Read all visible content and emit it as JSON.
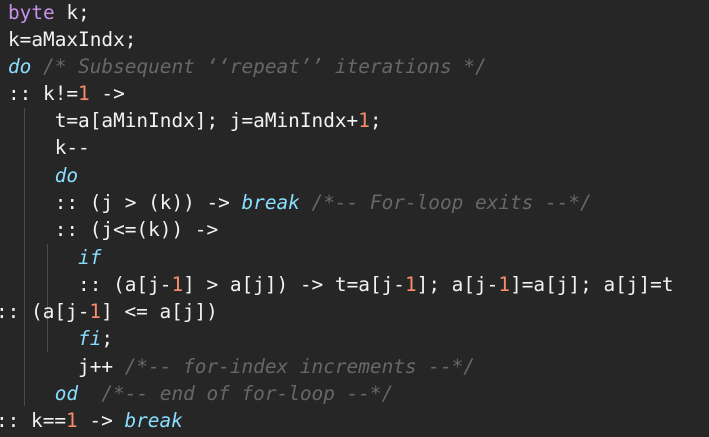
{
  "lines": [
    [
      {
        "t": "byte",
        "c": "kw-type"
      },
      {
        "t": " k;",
        "c": ""
      }
    ],
    [
      {
        "t": "k=aMaxIndx;",
        "c": ""
      }
    ],
    [
      {
        "t": "do",
        "c": "kw-ctrl"
      },
      {
        "t": " ",
        "c": ""
      },
      {
        "t": "/* Subsequent ‘‘repeat’’ iterations */",
        "c": "cmt"
      }
    ],
    [
      {
        "t": ":: k!=",
        "c": ""
      },
      {
        "t": "1",
        "c": "num"
      },
      {
        "t": " ->",
        "c": ""
      }
    ],
    [
      {
        "t": "    t=a[aMinIndx]; j=aMinIndx+",
        "c": ""
      },
      {
        "t": "1",
        "c": "num"
      },
      {
        "t": ";",
        "c": ""
      }
    ],
    [
      {
        "t": "    k--",
        "c": ""
      }
    ],
    [
      {
        "t": "    ",
        "c": ""
      },
      {
        "t": "do",
        "c": "kw-ctrl"
      }
    ],
    [
      {
        "t": "    :: (j > (k)) -> ",
        "c": ""
      },
      {
        "t": "break",
        "c": "kw-ctrl"
      },
      {
        "t": " ",
        "c": ""
      },
      {
        "t": "/*-- For-loop exits --*/",
        "c": "cmt"
      }
    ],
    [
      {
        "t": "    :: (j<=(k)) ->",
        "c": ""
      }
    ],
    [
      {
        "t": "      ",
        "c": ""
      },
      {
        "t": "if",
        "c": "kw-ctrl"
      }
    ],
    [
      {
        "t": "      :: (a[j-",
        "c": ""
      },
      {
        "t": "1",
        "c": "num"
      },
      {
        "t": "] > a[j]) -> t=a[j-",
        "c": ""
      },
      {
        "t": "1",
        "c": "num"
      },
      {
        "t": "]; a[j-",
        "c": ""
      },
      {
        "t": "1",
        "c": "num"
      },
      {
        "t": "]=a[j]; a[j]=t",
        "c": ""
      }
    ],
    [
      {
        "t": ":: (a[j-",
        "c": ""
      },
      {
        "t": "1",
        "c": "num"
      },
      {
        "t": "] <= a[j])",
        "c": ""
      }
    ],
    [
      {
        "t": "      ",
        "c": ""
      },
      {
        "t": "fi",
        "c": "kw-ctrl"
      },
      {
        "t": ";",
        "c": ""
      }
    ],
    [
      {
        "t": "      j++ ",
        "c": ""
      },
      {
        "t": "/*-- for-index increments --*/",
        "c": "cmt"
      }
    ],
    [
      {
        "t": "    ",
        "c": ""
      },
      {
        "t": "od",
        "c": "kw-ctrl"
      },
      {
        "t": "  ",
        "c": ""
      },
      {
        "t": "/*-- end of for-loop --*/",
        "c": "cmt"
      }
    ],
    [
      {
        "t": ":: k==",
        "c": ""
      },
      {
        "t": "1",
        "c": "num"
      },
      {
        "t": " -> ",
        "c": ""
      },
      {
        "t": "break",
        "c": "kw-ctrl"
      }
    ]
  ]
}
